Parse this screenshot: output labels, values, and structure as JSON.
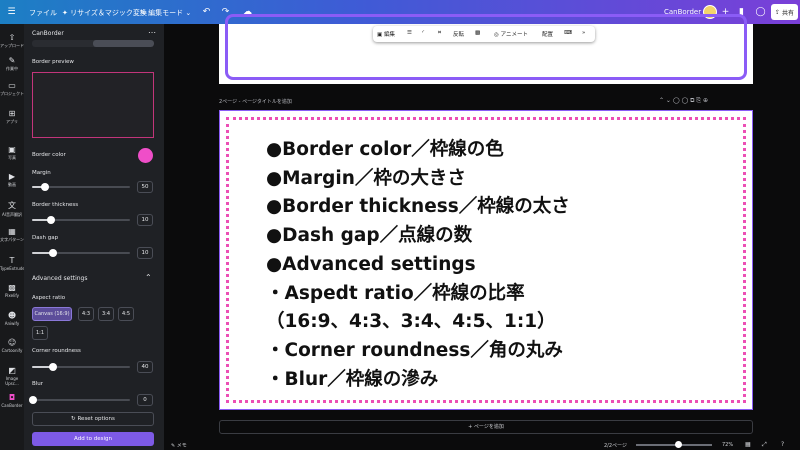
{
  "topbar": {
    "file": "ファイル",
    "resize": "リサイズ＆マジック変換",
    "edit_mode": "編集モード",
    "app_name": "CanBorder",
    "share": "共有"
  },
  "rail": [
    {
      "label": "アップロード",
      "icon": "upload-icon"
    },
    {
      "label": "作業中",
      "icon": "draw-icon"
    },
    {
      "label": "プロジェクト",
      "icon": "folder-icon"
    },
    {
      "label": "アプリ",
      "icon": "apps-icon"
    },
    {
      "label": "写真",
      "icon": "photo-icon"
    },
    {
      "label": "動画",
      "icon": "video-icon"
    },
    {
      "label": "AI音声翻訳",
      "icon": "translate-icon"
    },
    {
      "label": "文字パターン",
      "icon": "text-icon"
    },
    {
      "label": "TypeExtrude",
      "icon": "type-icon"
    },
    {
      "label": "Pixelify",
      "icon": "pixel-icon"
    },
    {
      "label": "Aniwify",
      "icon": "anime-icon"
    },
    {
      "label": "Cartoonify",
      "icon": "cartoon-icon"
    },
    {
      "label": "Image Upsc...",
      "icon": "upscale-icon"
    },
    {
      "label": "CanBorder",
      "icon": "border-icon"
    }
  ],
  "panel": {
    "title": "CanBorder",
    "border_preview": "Border preview",
    "border_color": "Border color",
    "margin_label": "Margin",
    "margin_value": "50",
    "thickness_label": "Border thickness",
    "thickness_value": "10",
    "dash_label": "Dash gap",
    "dash_value": "10",
    "advanced": "Advanced settings",
    "aspect_label": "Aspect ratio",
    "aspect_options": [
      "Canvas (16:9)",
      "4:3",
      "3:4",
      "4:5",
      "1:1"
    ],
    "corner_label": "Corner roundness",
    "corner_value": "40",
    "blur_label": "Blur",
    "blur_value": "0",
    "reset": "Reset options",
    "add": "Add to design"
  },
  "sliders": {
    "margin": 0.12,
    "thickness": 0.18,
    "dash": 0.2,
    "corner": 0.2,
    "blur": 0.0
  },
  "colors": {
    "border_color": "#ef4ec8",
    "accent": "#7d5ae6",
    "frame_purple": "#8b5cf6",
    "dots_pink": "#ec4fb5"
  },
  "toolbar": {
    "edit": "編集",
    "flip": "反転",
    "animate": "アニメート",
    "arrange": "配置"
  },
  "page_bar": "2ページ - ページタイトルを追加",
  "content_lines": [
    "●Border color／枠線の色",
    "●Margin／枠の大きさ",
    "●Border thickness／枠線の太さ",
    "●Dash gap／点線の数",
    "●Advanced settings",
    "・Aspedt ratio／枠線の比率",
    "（16:9、4:3、3:4、4:5、1:1）",
    "・Corner roundness／角の丸み",
    "・Blur／枠線の滲み"
  ],
  "add_page": "+ ページを追加",
  "bottom": {
    "memo": "メモ",
    "pages": "2/2ページ",
    "zoom": "72%"
  }
}
